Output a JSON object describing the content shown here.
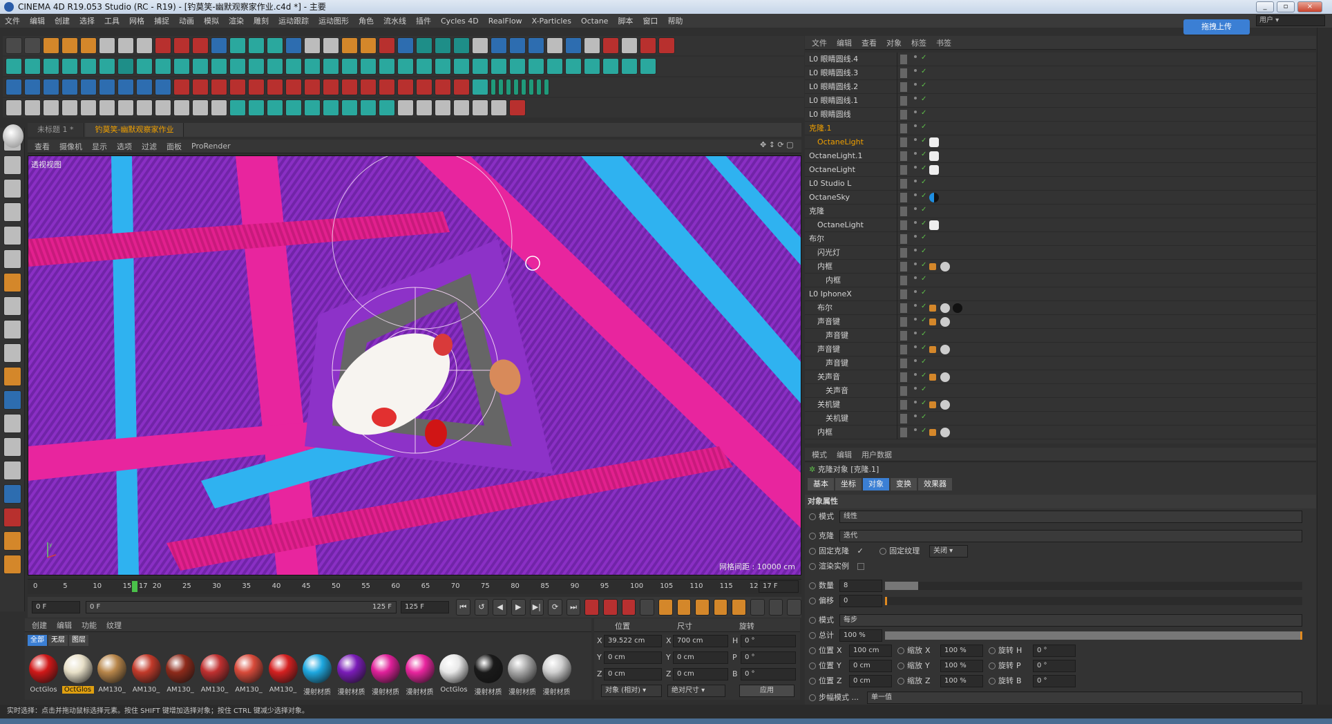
{
  "window": {
    "title": "CINEMA 4D R19.053 Studio (RC - R19) - [钓莫笑-幽默观察家作业.c4d *] - 主要",
    "controls": [
      "_",
      "▫",
      "×"
    ]
  },
  "menu": [
    "文件",
    "编辑",
    "创建",
    "选择",
    "工具",
    "网格",
    "捕捉",
    "动画",
    "模拟",
    "渲染",
    "雕刻",
    "运动跟踪",
    "运动图形",
    "角色",
    "流水线",
    "插件",
    "Cycles 4D",
    "RealFlow",
    "X-Particles",
    "Octane",
    "脚本",
    "窗口",
    "帮助"
  ],
  "upload_button": "拖拽上传",
  "layout_label": "用户",
  "viewport_tabs": [
    {
      "label": "未标题 1 *",
      "active": false
    },
    {
      "label": "钓莫笑-幽默观察家作业",
      "active": true
    }
  ],
  "viewport_menu": [
    "查看",
    "摄像机",
    "显示",
    "选项",
    "过滤",
    "面板",
    "ProRender"
  ],
  "viewport_label": "透视视图",
  "grid_spacing": "网格间距 : 10000 cm",
  "timeline": {
    "ticks": [
      "0",
      "5",
      "10",
      "15",
      "20",
      "25",
      "30",
      "35",
      "40",
      "45",
      "50",
      "55",
      "60",
      "65",
      "70",
      "75",
      "80",
      "85",
      "90",
      "95",
      "100",
      "105",
      "110",
      "115",
      "120",
      "12"
    ],
    "current": "17",
    "current_frame": "17 F",
    "start": "0 F",
    "range_start": "0 F",
    "range_end": "125 F",
    "end": "125 F"
  },
  "material_menu": [
    "创建",
    "编辑",
    "功能",
    "纹理"
  ],
  "material_filters": [
    "全部",
    "无层",
    "图层"
  ],
  "materials": [
    {
      "name": "OctGlos",
      "color": "#d01818"
    },
    {
      "name": "OctGlos",
      "color": "#e8e0c8",
      "selected": true
    },
    {
      "name": "AM130_",
      "color": "#b8864a"
    },
    {
      "name": "AM130_",
      "color": "#c23a2a"
    },
    {
      "name": "AM130_",
      "color": "#8e2a1a"
    },
    {
      "name": "AM130_",
      "color": "#c03030"
    },
    {
      "name": "AM130_",
      "color": "#d84a3a"
    },
    {
      "name": "AM130_",
      "color": "#d42020"
    },
    {
      "name": "漫射材质",
      "color": "#1ea8e0"
    },
    {
      "name": "漫射材质",
      "color": "#7a1cb8"
    },
    {
      "name": "漫射材质",
      "color": "#e0209a"
    },
    {
      "name": "漫射材质",
      "color": "#e8259e"
    },
    {
      "name": "OctGlos",
      "color": "#e8e8e8"
    },
    {
      "name": "漫射材质",
      "color": "#1a1a1a"
    },
    {
      "name": "漫射材质",
      "color": "#a8a8a8"
    },
    {
      "name": "漫射材质",
      "color": "#cfcfcf"
    }
  ],
  "coords": {
    "headers": [
      "位置",
      "尺寸",
      "旋转"
    ],
    "rows": [
      {
        "axis": "X",
        "pos": "39.522 cm",
        "size_axis": "X",
        "size": "700 cm",
        "rot_axis": "H",
        "rot": "0 °"
      },
      {
        "axis": "Y",
        "pos": "0 cm",
        "size_axis": "Y",
        "size": "0 cm",
        "rot_axis": "P",
        "rot": "0 °"
      },
      {
        "axis": "Z",
        "pos": "0 cm",
        "size_axis": "Z",
        "size": "0 cm",
        "rot_axis": "B",
        "rot": "0 °"
      }
    ],
    "mode1": "对象 (相对)",
    "mode2": "绝对尺寸",
    "apply": "应用"
  },
  "status": "实时选择：点击并拖动鼠标选择元素。按住 SHIFT 键增加选择对象；按住 CTRL 键减少选择对象。",
  "object_manager": {
    "menu": [
      "文件",
      "编辑",
      "查看",
      "对象",
      "标签",
      "书签"
    ],
    "objects": [
      {
        "name": "L0 眼睛圆线.4",
        "indent": 0,
        "tag": ""
      },
      {
        "name": "L0 眼睛圆线.3",
        "indent": 0,
        "tag": ""
      },
      {
        "name": "L0 眼睛圆线.2",
        "indent": 0,
        "tag": ""
      },
      {
        "name": "L0 眼睛圆线.1",
        "indent": 0,
        "tag": ""
      },
      {
        "name": "L0 眼睛圆线",
        "indent": 0,
        "tag": ""
      },
      {
        "name": "克隆.1",
        "indent": 0,
        "tag": "",
        "highlight": true
      },
      {
        "name": "OctaneLight",
        "indent": 1,
        "tag": "light",
        "highlight": true
      },
      {
        "name": "OctaneLight.1",
        "indent": 0,
        "tag": "light"
      },
      {
        "name": "OctaneLight",
        "indent": 0,
        "tag": "light"
      },
      {
        "name": "L0 Studio L",
        "indent": 0,
        "tag": ""
      },
      {
        "name": "OctaneSky",
        "indent": 0,
        "tag": "sky"
      },
      {
        "name": "克隆",
        "indent": 0,
        "tag": ""
      },
      {
        "name": "OctaneLight",
        "indent": 1,
        "tag": "light"
      },
      {
        "name": "布尔",
        "indent": 0,
        "tag": ""
      },
      {
        "name": "闪光灯",
        "indent": 1,
        "tag": ""
      },
      {
        "name": "内框",
        "indent": 1,
        "tag": "mat"
      },
      {
        "name": "内框",
        "indent": 2,
        "tag": ""
      },
      {
        "name": "L0 IphoneX",
        "indent": 0,
        "tag": ""
      },
      {
        "name": "布尔",
        "indent": 1,
        "tag": "mat2"
      },
      {
        "name": "声音键",
        "indent": 1,
        "tag": "mat"
      },
      {
        "name": "声音键",
        "indent": 2,
        "tag": ""
      },
      {
        "name": "声音键",
        "indent": 1,
        "tag": "mat"
      },
      {
        "name": "声音键",
        "indent": 2,
        "tag": ""
      },
      {
        "name": "关声音",
        "indent": 1,
        "tag": "mat"
      },
      {
        "name": "关声音",
        "indent": 2,
        "tag": ""
      },
      {
        "name": "关机键",
        "indent": 1,
        "tag": "mat"
      },
      {
        "name": "关机键",
        "indent": 2,
        "tag": ""
      },
      {
        "name": "内框",
        "indent": 1,
        "tag": "mat"
      }
    ]
  },
  "attributes": {
    "menu": [
      "模式",
      "编辑",
      "用户数据"
    ],
    "title": "克隆对象 [克隆.1]",
    "tabs": [
      {
        "label": "基本",
        "active": false
      },
      {
        "label": "坐标",
        "active": false
      },
      {
        "label": "对象",
        "active": true
      },
      {
        "label": "变换",
        "active": false
      },
      {
        "label": "效果器",
        "active": false
      }
    ],
    "section": "对象属性",
    "mode_label": "模式",
    "mode_value": "线性",
    "clone_label": "克隆",
    "clone_value": "迭代",
    "fixed_clone_label": "固定克隆",
    "fixed_clone_check": "✓",
    "fixed_texture_label": "固定纹理",
    "fixed_texture_value": "关闭",
    "render_instance_label": "渲染实例",
    "count_label": "数量",
    "count_value": "8",
    "count_fill": 0.08,
    "offset_label": "偏移",
    "offset_value": "0",
    "mode2_label": "模式",
    "mode2_value": "每步",
    "total_label": "总计",
    "total_value": "100 %",
    "pos_label": "位置",
    "scale_label": "缩放",
    "rot_label": "旋转",
    "vec": [
      {
        "a": "X",
        "pos": "100 cm",
        "scale": "100 %",
        "rot_axis": "H",
        "rot": "0 °"
      },
      {
        "a": "Y",
        "pos": "0 cm",
        "scale": "100 %",
        "rot_axis": "P",
        "rot": "0 °"
      },
      {
        "a": "Z",
        "pos": "0 cm",
        "scale": "100 %",
        "rot_axis": "B",
        "rot": "0 °"
      }
    ],
    "step_mode_label": "步幅模式",
    "step_mode_value": "单一值"
  }
}
